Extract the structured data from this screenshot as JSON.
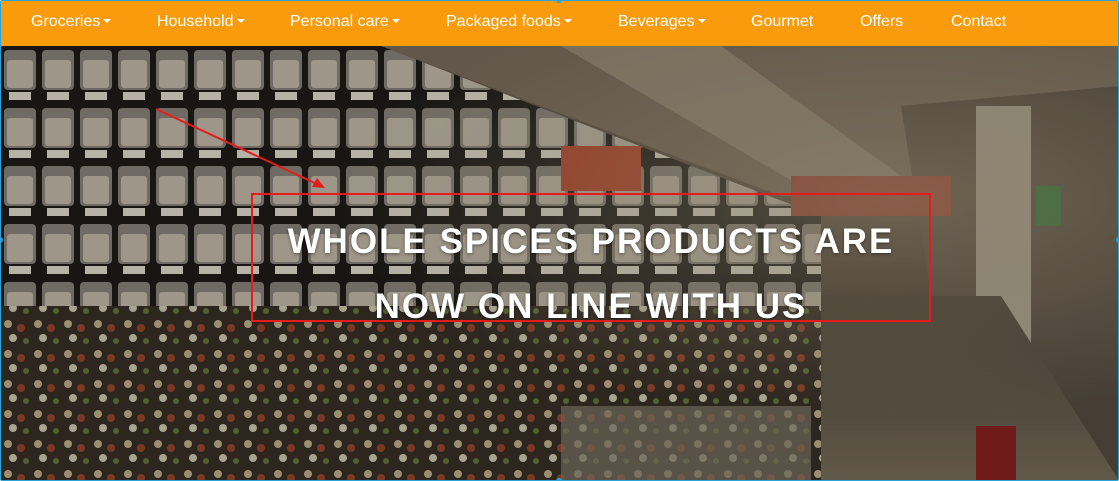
{
  "nav": {
    "items": [
      {
        "label": "Groceries",
        "has_dropdown": true
      },
      {
        "label": "Household",
        "has_dropdown": true
      },
      {
        "label": "Personal care",
        "has_dropdown": true
      },
      {
        "label": "Packaged foods",
        "has_dropdown": true
      },
      {
        "label": "Beverages",
        "has_dropdown": true
      },
      {
        "label": "Gourmet",
        "has_dropdown": false
      },
      {
        "label": "Offers",
        "has_dropdown": false
      },
      {
        "label": "Contact",
        "has_dropdown": false
      }
    ]
  },
  "hero": {
    "headline_line1": "WHOLE SPICES PRODUCTS ARE",
    "headline_line2": "NOW ON LINE WITH US",
    "background": "supermarket-aisle-photo"
  },
  "colors": {
    "nav_background": "#f99b0a",
    "nav_text": "#ffffff",
    "headline_border": "#e61c1c",
    "headline_text": "#ffffff",
    "selection_outline": "#2aa4d8"
  }
}
